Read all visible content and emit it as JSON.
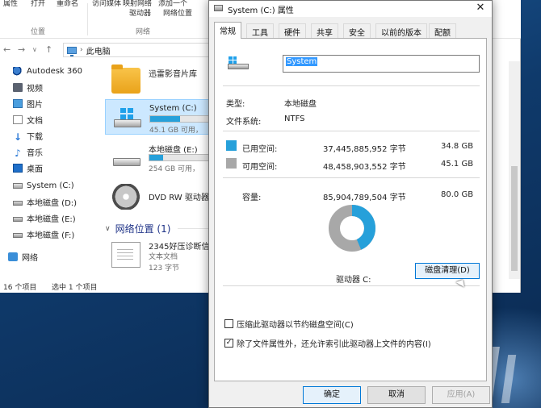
{
  "explorer": {
    "ribbon": {
      "items": [
        "属性",
        "打开",
        "重命名",
        "访问媒体",
        "映射网络",
        "添加一个",
        "驱动器",
        "网络位置"
      ],
      "groups": [
        "位置",
        "网络"
      ]
    },
    "address": "此电脑",
    "sidebar": {
      "items": [
        "Autodesk 360",
        "视频",
        "图片",
        "文档",
        "下载",
        "音乐",
        "桌面",
        "System (C:)",
        "本地磁盘 (D:)",
        "本地磁盘 (E:)",
        "本地磁盘 (F:)",
        "网络"
      ]
    },
    "content": {
      "items": [
        {
          "name": "迅雷影音片库",
          "size": ""
        },
        {
          "name": "System (C:)",
          "size": "45.1 GB 可用，",
          "used_fraction": 0.44
        },
        {
          "name": "本地磁盘 (E:)",
          "size": "254 GB 可用，",
          "used_fraction": 0.2
        },
        {
          "name": "DVD RW 驱动器",
          "size": ""
        }
      ],
      "network_section": "网络位置 (1)",
      "network_item": {
        "name": "2345好压诊断信",
        "type": "文本文档",
        "size": "123 字节"
      }
    },
    "status": {
      "count": "16 个项目",
      "selected": "选中 1 个项目"
    }
  },
  "dialog": {
    "title": "System (C:) 属性",
    "close": "✕",
    "tabs": [
      "常规",
      "工具",
      "硬件",
      "共享",
      "安全",
      "以前的版本",
      "配额"
    ],
    "name_value": "System",
    "type_label": "类型:",
    "type_value": "本地磁盘",
    "fs_label": "文件系统:",
    "fs_value": "NTFS",
    "used": {
      "label": "已用空间:",
      "bytes": "37,445,885,952 字节",
      "gb": "34.8 GB",
      "color": "#26a0da"
    },
    "free": {
      "label": "可用空间:",
      "bytes": "48,458,903,552 字节",
      "gb": "45.1 GB",
      "color": "#a8a8a8"
    },
    "capacity": {
      "label": "容量:",
      "bytes": "85,904,789,504 字节",
      "gb": "80.0 GB"
    },
    "used_fraction": 0.436,
    "drive_label": "驱动器 C:",
    "cleanup_button": "磁盘清理(D)",
    "compress_label": "压缩此驱动器以节约磁盘空间(C)",
    "compress_checked": false,
    "index_label": "除了文件属性外，还允许索引此驱动器上文件的内容(I)",
    "index_checked": true,
    "buttons": {
      "ok": "确定",
      "cancel": "取消",
      "apply": "应用(A)"
    }
  }
}
